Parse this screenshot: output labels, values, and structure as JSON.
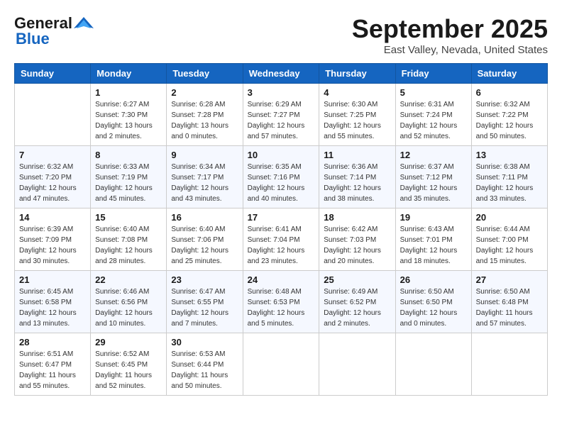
{
  "logo": {
    "line1": "General",
    "line2": "Blue",
    "icon": "▶"
  },
  "title": "September 2025",
  "location": "East Valley, Nevada, United States",
  "weekdays": [
    "Sunday",
    "Monday",
    "Tuesday",
    "Wednesday",
    "Thursday",
    "Friday",
    "Saturday"
  ],
  "weeks": [
    [
      {
        "day": "",
        "info": ""
      },
      {
        "day": "1",
        "info": "Sunrise: 6:27 AM\nSunset: 7:30 PM\nDaylight: 13 hours\nand 2 minutes."
      },
      {
        "day": "2",
        "info": "Sunrise: 6:28 AM\nSunset: 7:28 PM\nDaylight: 13 hours\nand 0 minutes."
      },
      {
        "day": "3",
        "info": "Sunrise: 6:29 AM\nSunset: 7:27 PM\nDaylight: 12 hours\nand 57 minutes."
      },
      {
        "day": "4",
        "info": "Sunrise: 6:30 AM\nSunset: 7:25 PM\nDaylight: 12 hours\nand 55 minutes."
      },
      {
        "day": "5",
        "info": "Sunrise: 6:31 AM\nSunset: 7:24 PM\nDaylight: 12 hours\nand 52 minutes."
      },
      {
        "day": "6",
        "info": "Sunrise: 6:32 AM\nSunset: 7:22 PM\nDaylight: 12 hours\nand 50 minutes."
      }
    ],
    [
      {
        "day": "7",
        "info": "Sunrise: 6:32 AM\nSunset: 7:20 PM\nDaylight: 12 hours\nand 47 minutes."
      },
      {
        "day": "8",
        "info": "Sunrise: 6:33 AM\nSunset: 7:19 PM\nDaylight: 12 hours\nand 45 minutes."
      },
      {
        "day": "9",
        "info": "Sunrise: 6:34 AM\nSunset: 7:17 PM\nDaylight: 12 hours\nand 43 minutes."
      },
      {
        "day": "10",
        "info": "Sunrise: 6:35 AM\nSunset: 7:16 PM\nDaylight: 12 hours\nand 40 minutes."
      },
      {
        "day": "11",
        "info": "Sunrise: 6:36 AM\nSunset: 7:14 PM\nDaylight: 12 hours\nand 38 minutes."
      },
      {
        "day": "12",
        "info": "Sunrise: 6:37 AM\nSunset: 7:12 PM\nDaylight: 12 hours\nand 35 minutes."
      },
      {
        "day": "13",
        "info": "Sunrise: 6:38 AM\nSunset: 7:11 PM\nDaylight: 12 hours\nand 33 minutes."
      }
    ],
    [
      {
        "day": "14",
        "info": "Sunrise: 6:39 AM\nSunset: 7:09 PM\nDaylight: 12 hours\nand 30 minutes."
      },
      {
        "day": "15",
        "info": "Sunrise: 6:40 AM\nSunset: 7:08 PM\nDaylight: 12 hours\nand 28 minutes."
      },
      {
        "day": "16",
        "info": "Sunrise: 6:40 AM\nSunset: 7:06 PM\nDaylight: 12 hours\nand 25 minutes."
      },
      {
        "day": "17",
        "info": "Sunrise: 6:41 AM\nSunset: 7:04 PM\nDaylight: 12 hours\nand 23 minutes."
      },
      {
        "day": "18",
        "info": "Sunrise: 6:42 AM\nSunset: 7:03 PM\nDaylight: 12 hours\nand 20 minutes."
      },
      {
        "day": "19",
        "info": "Sunrise: 6:43 AM\nSunset: 7:01 PM\nDaylight: 12 hours\nand 18 minutes."
      },
      {
        "day": "20",
        "info": "Sunrise: 6:44 AM\nSunset: 7:00 PM\nDaylight: 12 hours\nand 15 minutes."
      }
    ],
    [
      {
        "day": "21",
        "info": "Sunrise: 6:45 AM\nSunset: 6:58 PM\nDaylight: 12 hours\nand 13 minutes."
      },
      {
        "day": "22",
        "info": "Sunrise: 6:46 AM\nSunset: 6:56 PM\nDaylight: 12 hours\nand 10 minutes."
      },
      {
        "day": "23",
        "info": "Sunrise: 6:47 AM\nSunset: 6:55 PM\nDaylight: 12 hours\nand 7 minutes."
      },
      {
        "day": "24",
        "info": "Sunrise: 6:48 AM\nSunset: 6:53 PM\nDaylight: 12 hours\nand 5 minutes."
      },
      {
        "day": "25",
        "info": "Sunrise: 6:49 AM\nSunset: 6:52 PM\nDaylight: 12 hours\nand 2 minutes."
      },
      {
        "day": "26",
        "info": "Sunrise: 6:50 AM\nSunset: 6:50 PM\nDaylight: 12 hours\nand 0 minutes."
      },
      {
        "day": "27",
        "info": "Sunrise: 6:50 AM\nSunset: 6:48 PM\nDaylight: 11 hours\nand 57 minutes."
      }
    ],
    [
      {
        "day": "28",
        "info": "Sunrise: 6:51 AM\nSunset: 6:47 PM\nDaylight: 11 hours\nand 55 minutes."
      },
      {
        "day": "29",
        "info": "Sunrise: 6:52 AM\nSunset: 6:45 PM\nDaylight: 11 hours\nand 52 minutes."
      },
      {
        "day": "30",
        "info": "Sunrise: 6:53 AM\nSunset: 6:44 PM\nDaylight: 11 hours\nand 50 minutes."
      },
      {
        "day": "",
        "info": ""
      },
      {
        "day": "",
        "info": ""
      },
      {
        "day": "",
        "info": ""
      },
      {
        "day": "",
        "info": ""
      }
    ]
  ]
}
